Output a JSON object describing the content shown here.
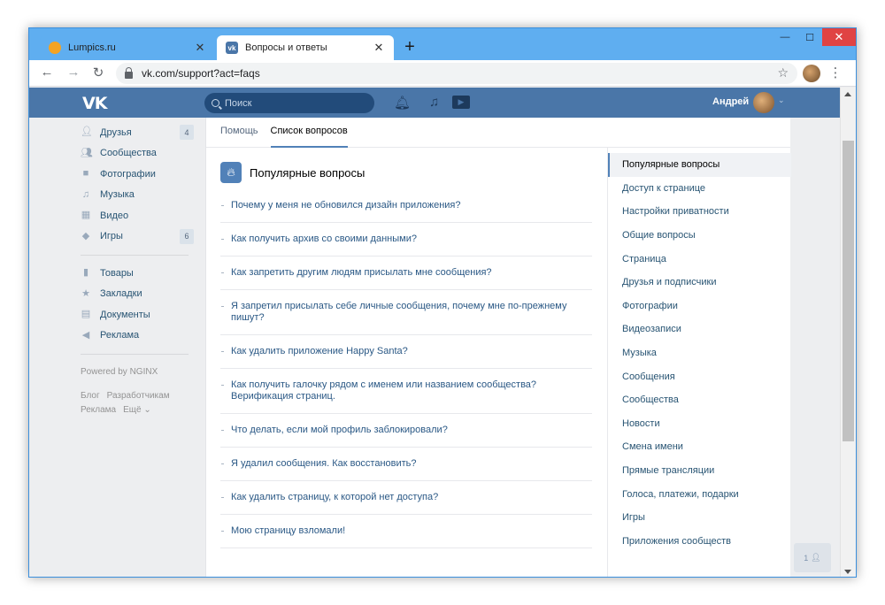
{
  "browser": {
    "tabs": [
      {
        "title": "Lumpics.ru",
        "active": false
      },
      {
        "title": "Вопросы и ответы",
        "active": true
      }
    ],
    "new_tab": "+",
    "url": "vk.com/support?act=faqs",
    "window_controls": {
      "minimize": "—",
      "maximize": "☐",
      "close": "✕"
    }
  },
  "vk_header": {
    "logo": "VK",
    "search_placeholder": "Поиск",
    "user_name": "Андрей"
  },
  "sidebar": {
    "items": [
      {
        "label": "Друзья",
        "icon": "person-icon",
        "count": "4"
      },
      {
        "label": "Сообщества",
        "icon": "group-icon",
        "count": ""
      },
      {
        "label": "Фотографии",
        "icon": "camera-icon",
        "count": ""
      },
      {
        "label": "Музыка",
        "icon": "music-icon",
        "count": ""
      },
      {
        "label": "Видео",
        "icon": "film-icon",
        "count": ""
      },
      {
        "label": "Игры",
        "icon": "gamepad-icon",
        "count": "6"
      }
    ],
    "items2": [
      {
        "label": "Товары",
        "icon": "bag-icon"
      },
      {
        "label": "Закладки",
        "icon": "star-icon"
      },
      {
        "label": "Документы",
        "icon": "document-icon"
      },
      {
        "label": "Реклама",
        "icon": "megaphone-icon"
      }
    ],
    "powered": "Powered by NGINX",
    "footer": {
      "blog": "Блог",
      "developers": "Разработчикам",
      "ads": "Реклама",
      "more": "Ещё ⌄"
    }
  },
  "content": {
    "tabs": [
      "Помощь",
      "Список вопросов"
    ],
    "section_title": "Популярные вопросы",
    "faq": [
      "Почему у меня не обновился дизайн приложения?",
      "Как получить архив со своими данными?",
      "Как запретить другим людям присылать мне сообщения?",
      "Я запретил присылать себе личные сообщения, почему мне по-прежнему пишут?",
      "Как удалить приложение Happy Santa?",
      "Как получить галочку рядом с именем или названием сообщества? Верификация страниц.",
      "Что делать, если мой профиль заблокировали?",
      "Я удалил сообщения. Как восстановить?",
      "Как удалить страницу, к которой нет доступа?",
      "Мою страницу взломали!"
    ],
    "categories": [
      "Популярные вопросы",
      "Доступ к странице",
      "Настройки приватности",
      "Общие вопросы",
      "Страница",
      "Друзья и подписчики",
      "Фотографии",
      "Видеозаписи",
      "Музыка",
      "Сообщения",
      "Сообщества",
      "Новости",
      "Смена имени",
      "Прямые трансляции",
      "Голоса, платежи, подарки",
      "Игры",
      "Приложения сообществ"
    ]
  },
  "chat": {
    "count": "1"
  }
}
